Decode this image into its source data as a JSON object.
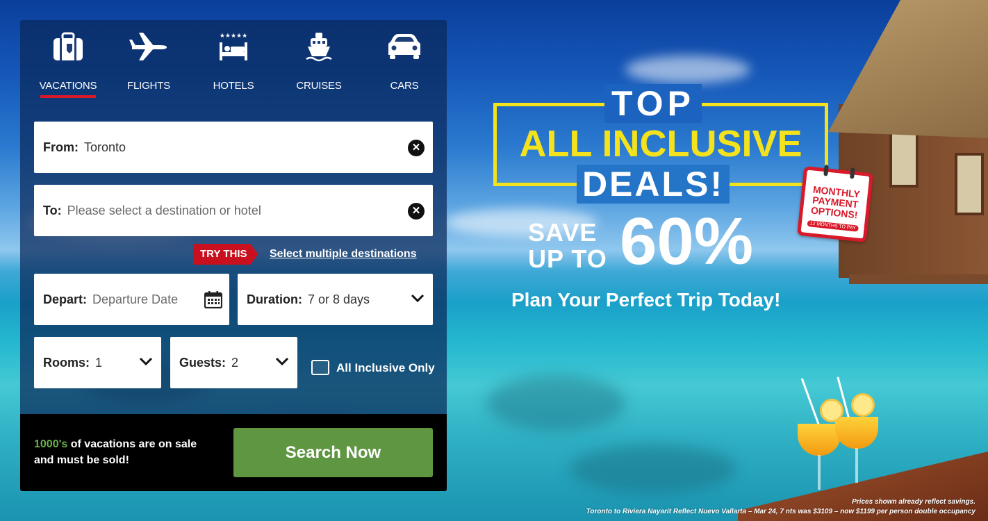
{
  "tabs": [
    {
      "label": "VACATIONS",
      "icon": "suitcase-icon",
      "active": true
    },
    {
      "label": "FLIGHTS",
      "icon": "airplane-icon",
      "active": false
    },
    {
      "label": "HOTELS",
      "icon": "hotel-bed-icon",
      "active": false
    },
    {
      "label": "CRUISES",
      "icon": "cruise-ship-icon",
      "active": false
    },
    {
      "label": "CARS",
      "icon": "car-icon",
      "active": false
    }
  ],
  "form": {
    "from": {
      "label": "From:",
      "value": "Toronto"
    },
    "to": {
      "label": "To:",
      "placeholder": "Please select a destination or hotel"
    },
    "try_this": "TRY THIS",
    "multi_link": "Select multiple destinations",
    "depart": {
      "label": "Depart:",
      "placeholder": "Departure Date"
    },
    "duration": {
      "label": "Duration:",
      "value": "7 or 8 days"
    },
    "rooms": {
      "label": "Rooms:",
      "value": "1"
    },
    "guests": {
      "label": "Guests:",
      "value": "2"
    },
    "all_inclusive": {
      "label": "All Inclusive Only",
      "checked": false
    }
  },
  "bottom": {
    "highlight": "1000's",
    "message_rest": " of vacations are on sale",
    "message_line2": "and must be sold!",
    "search_button": "Search Now"
  },
  "promo": {
    "top": "TOP",
    "all_inclusive": "ALL INCLUSIVE",
    "deals": "DEALS!",
    "save_line1": "SAVE",
    "save_line2": "UP TO",
    "percent": "60%",
    "tagline": "Plan Your Perfect Trip Today!",
    "badge_text": "MONTHLY PAYMENT OPTIONS!",
    "badge_sub": "12 MONTHS TO PAY"
  },
  "fineprint": {
    "line1": "Prices shown already reflect savings.",
    "line2": "Toronto to Riviera Nayarit Reflect Nuevo Vallarta – Mar 24, 7 nts was $3109 – now $1199 per person double occupancy"
  },
  "colors": {
    "accent_red": "#d8192a",
    "button_green": "#5f9641",
    "highlight_green": "#6ab24a",
    "promo_yellow": "#f4e21c"
  }
}
